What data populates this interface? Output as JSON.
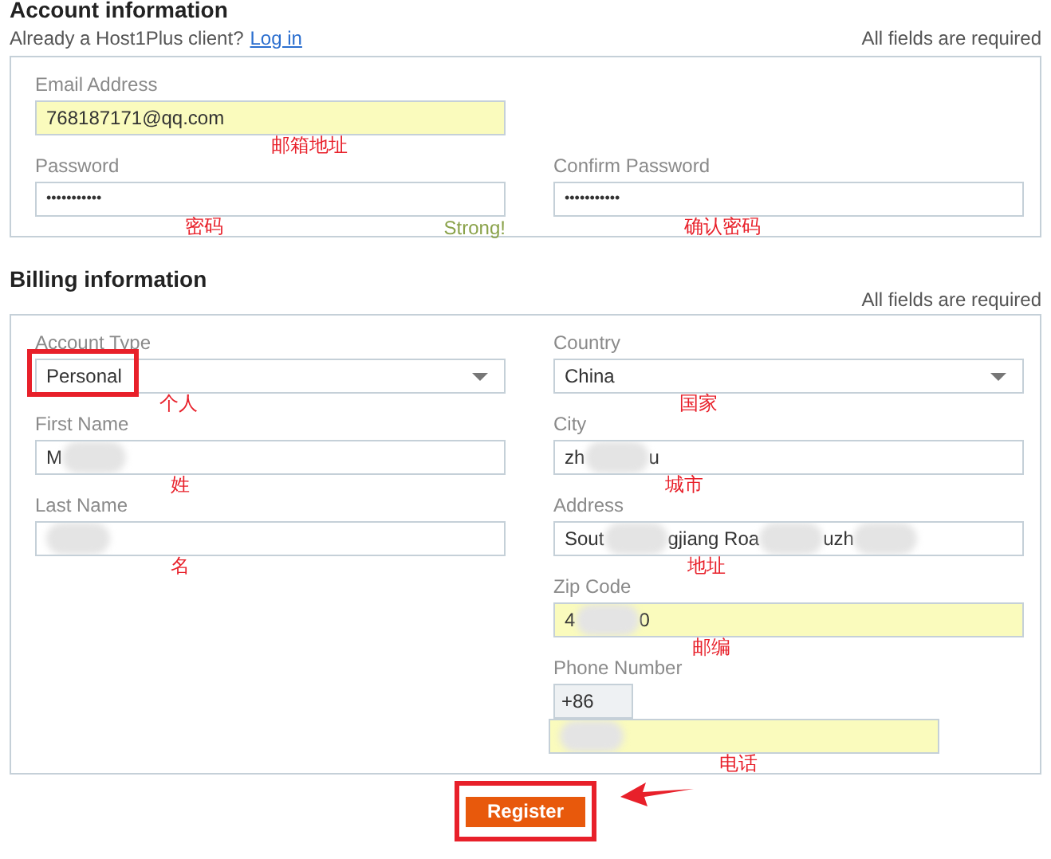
{
  "account": {
    "title": "Account information",
    "login_prompt": "Already a Host1Plus client?",
    "login_link": "Log in",
    "note": "All fields are required",
    "rows": [
      [
        {
          "label": "Email Address",
          "kind": "text",
          "autofilled": true,
          "value_parts": [
            {
              "kind": "text",
              "text": "768187171@qq.com"
            }
          ],
          "annotation": "邮箱地址"
        }
      ],
      [
        {
          "label": "Password",
          "kind": "password",
          "autofilled": false,
          "value_parts": [
            {
              "kind": "text",
              "text": "•••••••••••"
            }
          ],
          "annotation": "密码",
          "hint": "Strong!"
        },
        {
          "label": "Confirm Password",
          "kind": "password",
          "autofilled": false,
          "value_parts": [
            {
              "kind": "text",
              "text": "•••••••••••"
            }
          ],
          "annotation": "确认密码"
        }
      ]
    ]
  },
  "billing": {
    "title": "Billing information",
    "note": "All fields are required",
    "left": [
      {
        "label": "Account Type",
        "kind": "select",
        "autofilled": false,
        "marked": true,
        "value_parts": [
          {
            "kind": "text",
            "text": "Personal"
          }
        ],
        "annotation": "个人"
      },
      {
        "label": "First Name",
        "kind": "text",
        "autofilled": false,
        "value_parts": [
          {
            "kind": "text",
            "text": "M"
          },
          {
            "kind": "blur"
          }
        ],
        "annotation": "姓"
      },
      {
        "label": "Last Name",
        "kind": "text",
        "autofilled": false,
        "value_parts": [
          {
            "kind": "blur"
          }
        ],
        "annotation": "名"
      }
    ],
    "right": [
      {
        "label": "Country",
        "kind": "select",
        "autofilled": false,
        "value_parts": [
          {
            "kind": "text",
            "text": "China"
          }
        ],
        "annotation": "国家"
      },
      {
        "label": "City",
        "kind": "text",
        "autofilled": false,
        "value_parts": [
          {
            "kind": "text",
            "text": "zh"
          },
          {
            "kind": "blur"
          },
          {
            "kind": "text",
            "text": "u"
          }
        ],
        "annotation": "城市"
      },
      {
        "label": "Address",
        "kind": "text",
        "autofilled": false,
        "value_parts": [
          {
            "kind": "text",
            "text": "Sout"
          },
          {
            "kind": "blur"
          },
          {
            "kind": "text",
            "text": "gjiang Roa"
          },
          {
            "kind": "blur"
          },
          {
            "kind": "text",
            "text": "uzh"
          },
          {
            "kind": "blur"
          }
        ],
        "annotation": "地址"
      },
      {
        "label": "Zip Code",
        "kind": "text",
        "autofilled": true,
        "value_parts": [
          {
            "kind": "text",
            "text": "4"
          },
          {
            "kind": "blur"
          },
          {
            "kind": "text",
            "text": "0"
          }
        ],
        "annotation": "邮编"
      },
      {
        "label": "Phone Number",
        "kind": "phone",
        "prefix": "+86",
        "autofilled": true,
        "value_parts": [
          {
            "kind": "blur"
          }
        ],
        "annotation": "电话"
      }
    ]
  },
  "register": {
    "label": "Register",
    "marked": true
  }
}
